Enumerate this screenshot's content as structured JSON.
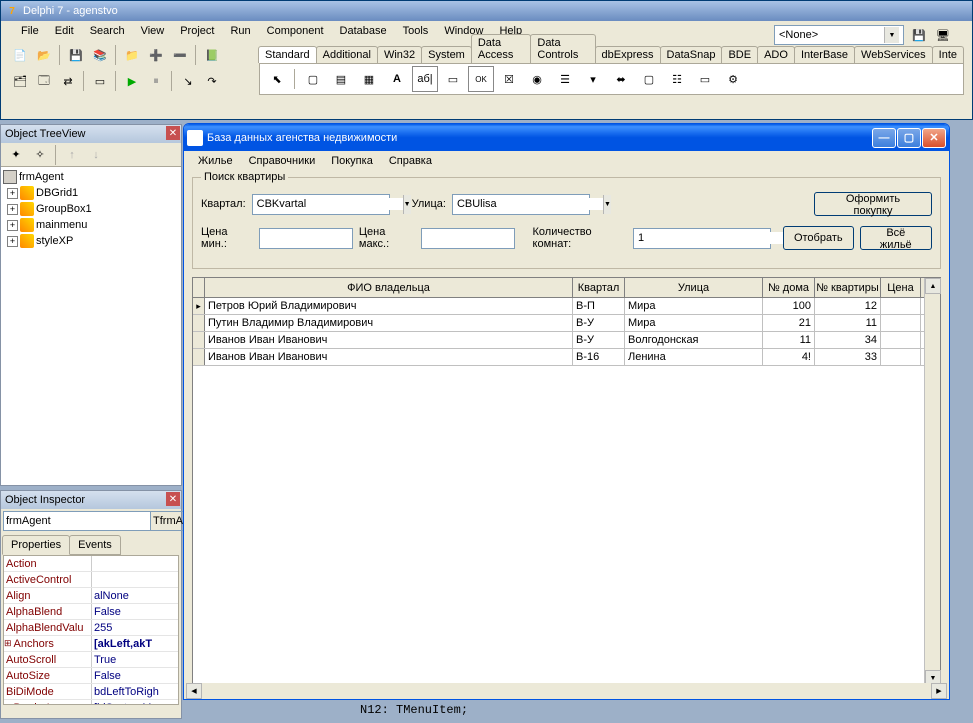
{
  "delphi": {
    "title": "Delphi 7 - agenstvo",
    "menu": [
      "File",
      "Edit",
      "Search",
      "View",
      "Project",
      "Run",
      "Component",
      "Database",
      "Tools",
      "Window",
      "Help"
    ],
    "combo_value": "<None>",
    "palette_tabs": [
      "Standard",
      "Additional",
      "Win32",
      "System",
      "Data Access",
      "Data Controls",
      "dbExpress",
      "DataSnap",
      "BDE",
      "ADO",
      "InterBase",
      "WebServices",
      "Inte"
    ],
    "active_palette": "Standard"
  },
  "treeview": {
    "title": "Object TreeView",
    "root": "frmAgent",
    "items": [
      "DBGrid1",
      "GroupBox1",
      "mainmenu",
      "styleXP"
    ]
  },
  "inspector": {
    "title": "Object Inspector",
    "obj_name": "frmAgent",
    "obj_type": "TfrmAgent",
    "tabs": [
      "Properties",
      "Events"
    ],
    "props": [
      {
        "name": "Action",
        "val": "",
        "expand": false
      },
      {
        "name": "ActiveControl",
        "val": "",
        "expand": false
      },
      {
        "name": "Align",
        "val": "alNone",
        "expand": false
      },
      {
        "name": "AlphaBlend",
        "val": "False",
        "expand": false
      },
      {
        "name": "AlphaBlendValu",
        "val": "255",
        "expand": false
      },
      {
        "name": "Anchors",
        "val": "[akLeft,akT",
        "expand": true,
        "bold": true
      },
      {
        "name": "AutoScroll",
        "val": "True",
        "expand": false
      },
      {
        "name": "AutoSize",
        "val": "False",
        "expand": false
      },
      {
        "name": "BiDiMode",
        "val": "bdLeftToRigh",
        "expand": false
      },
      {
        "name": "BorderIcons",
        "val": "[biSystemMen",
        "expand": true
      }
    ]
  },
  "app": {
    "title": "База данных агенства недвижимости",
    "menu": [
      "Жилье",
      "Справочники",
      "Покупка",
      "Справка"
    ],
    "groupbox_title": "Поиск квартиры",
    "kvartal_label": "Квартал:",
    "kvartal_value": "CBKvartal",
    "ulica_label": "Улица:",
    "ulica_value": "CBUlisa",
    "price_min_label": "Цена мин.:",
    "price_min_value": "",
    "price_max_label": "Цена макс.:",
    "price_max_value": "",
    "rooms_label": "Количество комнат:",
    "rooms_value": "1",
    "btn_buy": "Оформить покупку",
    "btn_filter": "Отобрать",
    "btn_all": "Всё жильё",
    "grid": {
      "headers": [
        "ФИО владельца",
        "Квартал",
        "Улица",
        "№ дома",
        "№ квартиры",
        "Цена"
      ],
      "rows": [
        {
          "fio": "Петров Юрий Владимирович",
          "kv": "В-П",
          "ul": "Мира",
          "dom": "100",
          "kva": "12",
          "cena": "",
          "current": true
        },
        {
          "fio": "Путин Владимир Владимирович",
          "kv": "В-У",
          "ul": "Мира",
          "dom": "21",
          "kva": "11",
          "cena": ""
        },
        {
          "fio": "Иванов Иван Иванович",
          "kv": "В-У",
          "ul": "Волгодонская",
          "dom": "11",
          "kva": "34",
          "cena": ""
        },
        {
          "fio": "Иванов Иван Иванович",
          "kv": "В-16",
          "ul": "Ленина",
          "dom": "4!",
          "kva": "33",
          "cena": ""
        }
      ]
    }
  },
  "code": "    N12: TMenuItem;"
}
